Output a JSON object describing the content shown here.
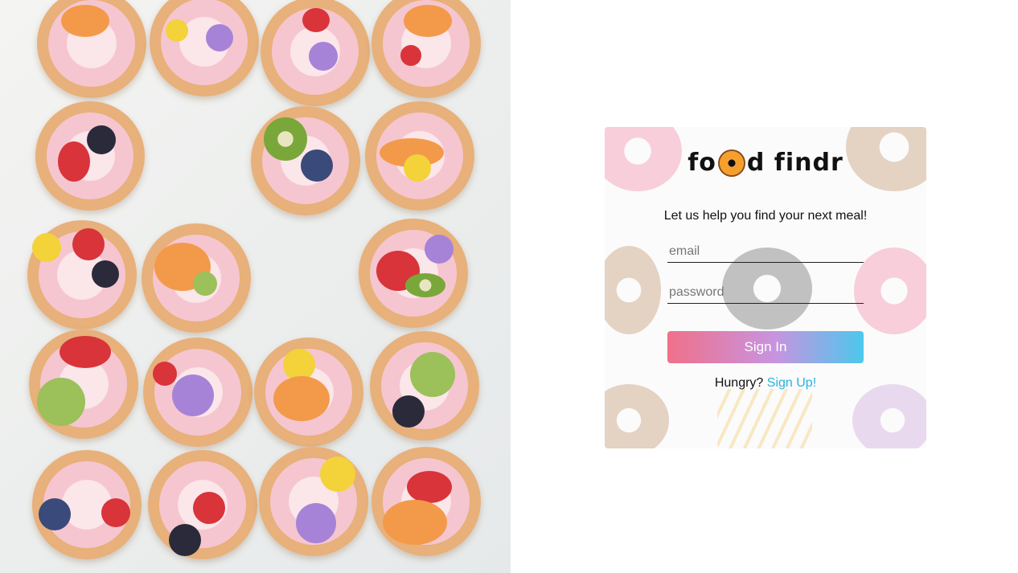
{
  "hero_image": {
    "alt_subject": "donuts with fruit and flowers"
  },
  "login": {
    "logo_left": "fo",
    "logo_right": "d findr",
    "tagline": "Let us help you find your next meal!",
    "email_placeholder": "email",
    "password_placeholder": "password",
    "signin_label": "Sign In",
    "signup_prompt": "Hungry?",
    "signup_link": "Sign Up!"
  },
  "colors": {
    "button_gradient_start": "#f0708a",
    "button_gradient_mid": "#c794e0",
    "button_gradient_end": "#4cc8ec",
    "link": "#29b3e0"
  }
}
